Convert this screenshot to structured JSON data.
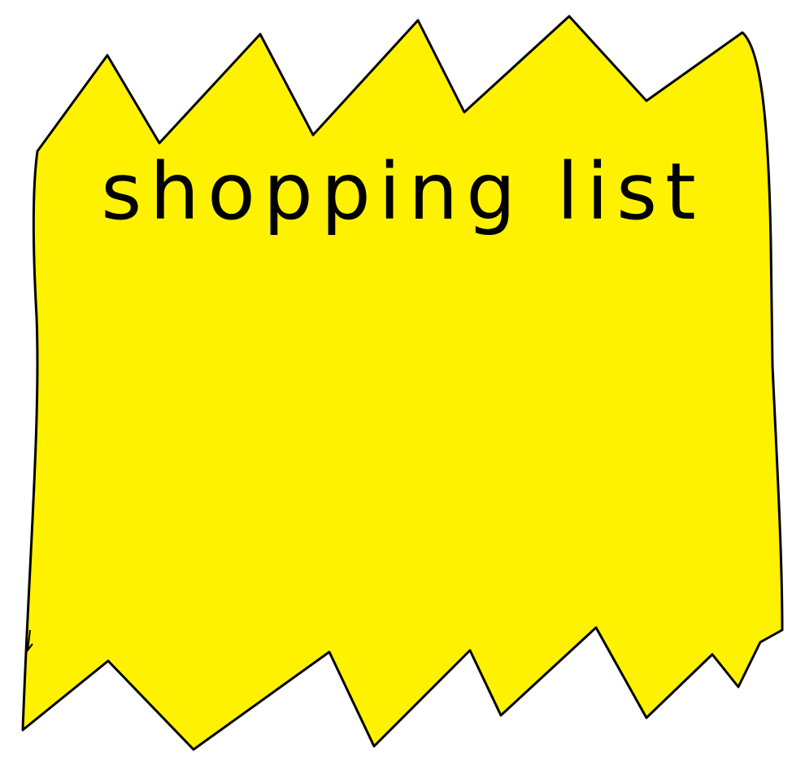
{
  "note": {
    "title": "shopping list",
    "fill_color": "#FFF200",
    "outline_color": "#000000",
    "shape": "torn-paper"
  }
}
